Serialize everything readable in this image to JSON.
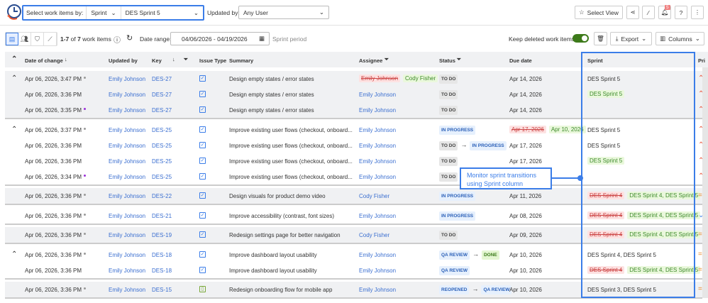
{
  "header": {
    "select_label": "Select work items by:",
    "select_mode": "Sprint",
    "select_value": "DES Sprint 5",
    "updated_by_label": "Updated by:",
    "updated_by_value": "Any User",
    "select_view": "Select View",
    "notifications": "5"
  },
  "toolbar": {
    "count_prefix": "1-7",
    "count_mid": " of ",
    "count_total": "7",
    "count_suffix": " work items",
    "date_range_label": "Date range:",
    "date_range": "04/06/2026 - 04/19/2026",
    "sprint_period": "Sprint period",
    "keep_deleted": "Keep deleted work items",
    "keep_deleted_on": true,
    "export": "Export",
    "columns": "Columns"
  },
  "table": {
    "headers": {
      "date": "Date of change",
      "updated_by": "Updated by",
      "key": "Key",
      "issue_type": "Issue Type",
      "summary": "Summary",
      "assignee": "Assignee",
      "status": "Status",
      "due": "Due date",
      "sprint": "Sprint",
      "priority": "Pri"
    }
  },
  "colors": {
    "accent": "#3b7de8",
    "old": "#c44444",
    "new": "#3d8a2a",
    "dot_gray": "#999999",
    "dot_purple": "#9b30d9"
  },
  "callout": "Monitor sprint transitions using Sprint column",
  "groups": [
    {
      "shade": true,
      "rows": [
        {
          "date": "Apr 06, 2026, 3:47 PM",
          "dot": "gray",
          "updated_by": "Emily Johnson",
          "key": "DES-27",
          "issue_type": "task",
          "summary": "Design empty states / error states",
          "assignee": [
            {
              "t": "Emily Johnson",
              "s": "old"
            },
            {
              "t": "Cody Fisher",
              "s": "new"
            }
          ],
          "status": [
            {
              "t": "TO DO",
              "s": "gray"
            }
          ],
          "due": [
            {
              "t": "Apr 14, 2026"
            }
          ],
          "sprint": [
            {
              "t": "DES Sprint 5"
            }
          ],
          "priority": "high"
        },
        {
          "date": "Apr 06, 2026, 3:36 PM",
          "dot": "",
          "updated_by": "Emily Johnson",
          "key": "DES-27",
          "issue_type": "task",
          "summary": "Design empty states / error states",
          "assignee": [
            {
              "t": "Emily Johnson",
              "s": "link"
            }
          ],
          "status": [
            {
              "t": "TO DO",
              "s": "gray"
            }
          ],
          "due": [
            {
              "t": "Apr 14, 2026"
            }
          ],
          "sprint": [
            {
              "t": "DES Sprint 5",
              "s": "new"
            }
          ],
          "priority": "high"
        },
        {
          "date": "Apr 06, 2026, 3:35 PM",
          "dot": "purple",
          "updated_by": "Emily Johnson",
          "key": "DES-27",
          "issue_type": "task",
          "summary": "Design empty states / error states",
          "assignee": [
            {
              "t": "Emily Johnson",
              "s": "link"
            }
          ],
          "status": [
            {
              "t": "TO DO",
              "s": "gray"
            }
          ],
          "due": [
            {
              "t": "Apr 14, 2026"
            }
          ],
          "sprint": [],
          "priority": "high"
        }
      ]
    },
    {
      "shade": false,
      "rows": [
        {
          "date": "Apr 06, 2026, 3:37 PM",
          "dot": "gray",
          "updated_by": "Emily Johnson",
          "key": "DES-25",
          "issue_type": "task",
          "summary": "Improve existing user flows (checkout, onboard...",
          "assignee": [
            {
              "t": "Emily Johnson",
              "s": "link"
            }
          ],
          "status": [
            {
              "t": "IN PROGRESS",
              "s": "blue"
            }
          ],
          "due": [
            {
              "t": "Apr 17, 2026",
              "s": "old"
            },
            {
              "t": "Apr 10, 2026",
              "s": "new"
            }
          ],
          "sprint": [
            {
              "t": "DES Sprint 5"
            }
          ],
          "priority": "high"
        },
        {
          "date": "Apr 06, 2026, 3:36 PM",
          "dot": "",
          "updated_by": "Emily Johnson",
          "key": "DES-25",
          "issue_type": "task",
          "summary": "Improve existing user flows (checkout, onboard...",
          "assignee": [
            {
              "t": "Emily Johnson",
              "s": "link"
            }
          ],
          "status": [
            {
              "t": "TO DO",
              "s": "gray"
            },
            {
              "t": "IN PROGRESS",
              "s": "blue"
            }
          ],
          "due": [
            {
              "t": "Apr 17, 2026"
            }
          ],
          "sprint": [
            {
              "t": "DES Sprint 5"
            }
          ],
          "priority": "high"
        },
        {
          "date": "Apr 06, 2026, 3:36 PM",
          "dot": "",
          "updated_by": "Emily Johnson",
          "key": "DES-25",
          "issue_type": "task",
          "summary": "Improve existing user flows (checkout, onboard...",
          "assignee": [
            {
              "t": "Emily Johnson",
              "s": "link"
            }
          ],
          "status": [
            {
              "t": "TO DO",
              "s": "gray"
            }
          ],
          "due": [
            {
              "t": "Apr 17, 2026"
            }
          ],
          "sprint": [
            {
              "t": "DES Sprint 5",
              "s": "new"
            }
          ],
          "priority": "high"
        },
        {
          "date": "Apr 06, 2026, 3:34 PM",
          "dot": "purple",
          "updated_by": "Emily Johnson",
          "key": "DES-25",
          "issue_type": "task",
          "summary": "Improve existing user flows (checkout, onboard...",
          "assignee": [
            {
              "t": "Emily Johnson",
              "s": "link"
            }
          ],
          "status": [
            {
              "t": "TO DO",
              "s": "gray"
            }
          ],
          "due": [],
          "sprint": [],
          "priority": "high"
        }
      ]
    },
    {
      "shade": true,
      "rows": [
        {
          "date": "Apr 06, 2026, 3:36 PM",
          "dot": "gray",
          "updated_by": "Emily Johnson",
          "key": "DES-22",
          "issue_type": "task",
          "summary": "Design visuals for product demo video",
          "assignee": [
            {
              "t": "Cody Fisher",
              "s": "link"
            }
          ],
          "status": [
            {
              "t": "IN PROGRESS",
              "s": "blue"
            }
          ],
          "due": [
            {
              "t": "Apr 11, 2026"
            }
          ],
          "sprint": [
            {
              "t": "DES Sprint 4",
              "s": "old"
            },
            {
              "t": "DES Sprint 4, DES Sprint 5",
              "s": "new"
            }
          ],
          "priority": "medium"
        }
      ]
    },
    {
      "shade": false,
      "rows": [
        {
          "date": "Apr 06, 2026, 3:36 PM",
          "dot": "gray",
          "updated_by": "Emily Johnson",
          "key": "DES-21",
          "issue_type": "task",
          "summary": "Improve accessibility (contrast, font sizes)",
          "assignee": [
            {
              "t": "Emily Johnson",
              "s": "link"
            }
          ],
          "status": [
            {
              "t": "IN PROGRESS",
              "s": "blue"
            }
          ],
          "due": [
            {
              "t": "Apr 08, 2026"
            }
          ],
          "sprint": [
            {
              "t": "DES Sprint 4",
              "s": "old"
            },
            {
              "t": "DES Sprint 4, DES Sprint 5",
              "s": "new"
            }
          ],
          "priority": "low"
        }
      ]
    },
    {
      "shade": true,
      "rows": [
        {
          "date": "Apr 06, 2026, 3:36 PM",
          "dot": "gray",
          "updated_by": "Emily Johnson",
          "key": "DES-19",
          "issue_type": "task",
          "summary": "Redesign settings page for better navigation",
          "assignee": [
            {
              "t": "Cody Fisher",
              "s": "link"
            }
          ],
          "status": [
            {
              "t": "TO DO",
              "s": "gray"
            }
          ],
          "due": [
            {
              "t": "Apr 09, 2026"
            }
          ],
          "sprint": [
            {
              "t": "DES Sprint 4",
              "s": "old"
            },
            {
              "t": "DES Sprint 4, DES Sprint 5",
              "s": "new"
            }
          ],
          "priority": "medium"
        }
      ]
    },
    {
      "shade": false,
      "rows": [
        {
          "date": "Apr 06, 2026, 3:36 PM",
          "dot": "gray",
          "updated_by": "Emily Johnson",
          "key": "DES-18",
          "issue_type": "task",
          "summary": "Improve dashboard layout usability",
          "assignee": [
            {
              "t": "Emily Johnson",
              "s": "link"
            }
          ],
          "status": [
            {
              "t": "QA REVIEW",
              "s": "blue"
            },
            {
              "t": "DONE",
              "s": "green"
            }
          ],
          "due": [
            {
              "t": "Apr 10, 2026"
            }
          ],
          "sprint": [
            {
              "t": "DES Sprint 4, DES Sprint 5"
            }
          ],
          "priority": "medium"
        },
        {
          "date": "Apr 06, 2026, 3:36 PM",
          "dot": "",
          "updated_by": "Emily Johnson",
          "key": "DES-18",
          "issue_type": "task",
          "summary": "Improve dashboard layout usability",
          "assignee": [
            {
              "t": "Emily Johnson",
              "s": "link"
            }
          ],
          "status": [
            {
              "t": "QA REVIEW",
              "s": "blue"
            }
          ],
          "due": [
            {
              "t": "Apr 10, 2026"
            }
          ],
          "sprint": [
            {
              "t": "DES Sprint 4",
              "s": "old"
            },
            {
              "t": "DES Sprint 4, DES Sprint 5",
              "s": "new"
            }
          ],
          "priority": "medium"
        }
      ]
    },
    {
      "shade": true,
      "rows": [
        {
          "date": "Apr 06, 2026, 3:36 PM",
          "dot": "gray",
          "updated_by": "Emily Johnson",
          "key": "DES-15",
          "issue_type": "story",
          "summary": "Redesign onboarding flow for mobile app",
          "assignee": [
            {
              "t": "Emily Johnson",
              "s": "link"
            }
          ],
          "status": [
            {
              "t": "REOPENED",
              "s": "blue"
            },
            {
              "t": "QA REVIEW",
              "s": "blue"
            }
          ],
          "due": [
            {
              "t": "Apr 10, 2026"
            }
          ],
          "sprint": [
            {
              "t": "DES Sprint 3, DES Sprint 5"
            }
          ],
          "priority": "medium"
        }
      ]
    }
  ]
}
